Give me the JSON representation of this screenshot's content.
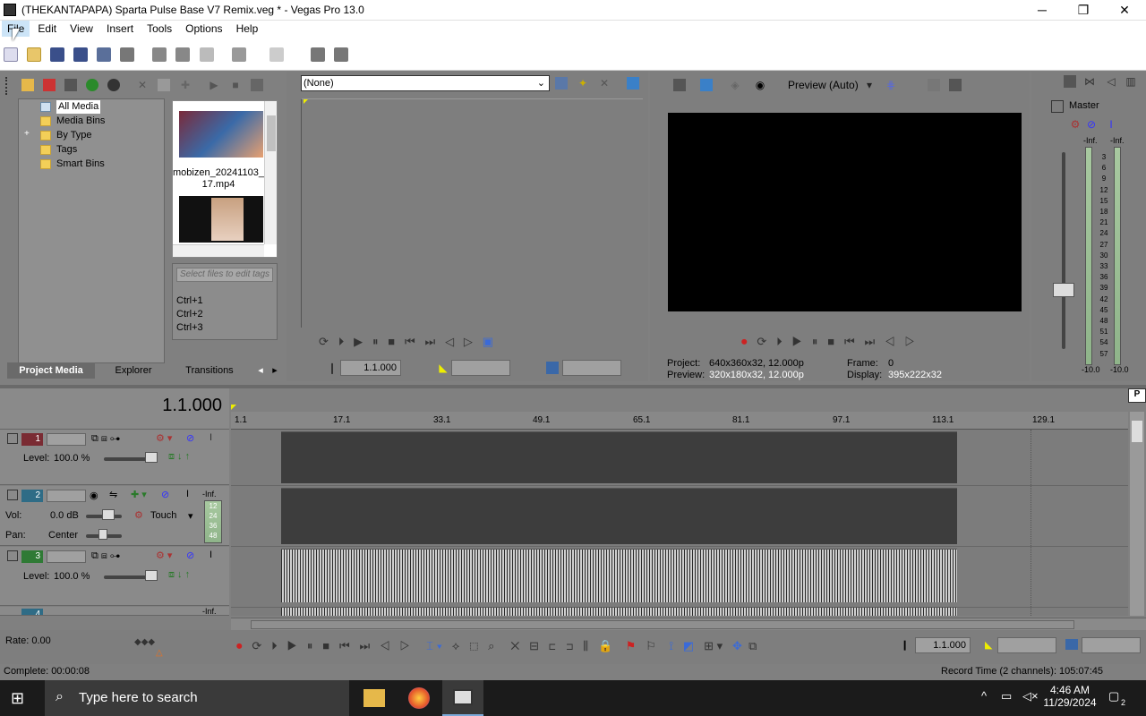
{
  "window": {
    "title": "(THEKANTAPAPA) Sparta Pulse Base V7 Remix.veg * - Vegas Pro 13.0",
    "minimize": "─",
    "maximize": "❐",
    "close": "✕"
  },
  "menu": [
    "File",
    "Edit",
    "View",
    "Insert",
    "Tools",
    "Options",
    "Help"
  ],
  "project_media": {
    "tree": [
      "All Media",
      "Media Bins",
      "By Type",
      "Tags",
      "Smart Bins"
    ],
    "expander": "+",
    "thumb_caption": "mobizen_20241103_\n17.mp4",
    "tag_placeholder": "Select files to edit tags",
    "shortcuts": [
      "Ctrl+1",
      "Ctrl+2",
      "Ctrl+3"
    ],
    "tabs": [
      "Project Media",
      "Explorer",
      "Transitions"
    ]
  },
  "trimmer": {
    "dropdown_value": "(None)",
    "timecode": "1.1.000"
  },
  "preview": {
    "mode": "Preview (Auto)",
    "project_label": "Project:",
    "project_value": "640x360x32, 12.000p",
    "preview_label": "Preview:",
    "preview_value": "320x180x32, 12.000p",
    "frame_label": "Frame:",
    "frame_value": "0",
    "display_label": "Display:",
    "display_value": "395x222x32"
  },
  "master": {
    "title": "Master",
    "inf_left": "-Inf.",
    "inf_right": "-Inf.",
    "scale": [
      "3",
      "6",
      "9",
      "12",
      "15",
      "18",
      "21",
      "24",
      "27",
      "30",
      "33",
      "36",
      "39",
      "42",
      "45",
      "48",
      "51",
      "54",
      "57"
    ],
    "bottom_left": "-10.0",
    "bottom_right": "-10.0"
  },
  "timeline": {
    "cursor_time": "1.1.000",
    "ruler": [
      "1.1",
      "17.1",
      "33.1",
      "49.1",
      "65.1",
      "81.1",
      "97.1",
      "113.1",
      "129.1"
    ],
    "tracks": [
      {
        "number": "1",
        "level_label": "Level:",
        "level_value": "100.0 %"
      },
      {
        "number": "2",
        "vol_label": "Vol:",
        "vol_value": "0.0 dB",
        "pan_label": "Pan:",
        "pan_value": "Center",
        "automation": "Touch",
        "inf": "-Inf.",
        "meter_scale": [
          "12",
          "24",
          "36",
          "48"
        ]
      },
      {
        "number": "3",
        "level_label": "Level:",
        "level_value": "100.0 %"
      },
      {
        "number": "4",
        "inf": "-Inf."
      }
    ],
    "rate_label": "Rate: 0.00",
    "transport_timecode": "1.1.000"
  },
  "status": {
    "complete": "Complete: 00:00:08",
    "record_time": "Record Time (2 channels): 105:07:45"
  },
  "taskbar": {
    "search_placeholder": "Type here to search",
    "time": "4:46 AM",
    "date": "11/29/2024",
    "notifications": "2"
  },
  "colors": {
    "panel_bg": "#808080",
    "track_video": "#3d3d3d",
    "taskbar": "#1b1b1b",
    "track1_badge": "#7a2b33",
    "track2_badge": "#2f6c86",
    "track3_badge": "#2f7a35"
  }
}
